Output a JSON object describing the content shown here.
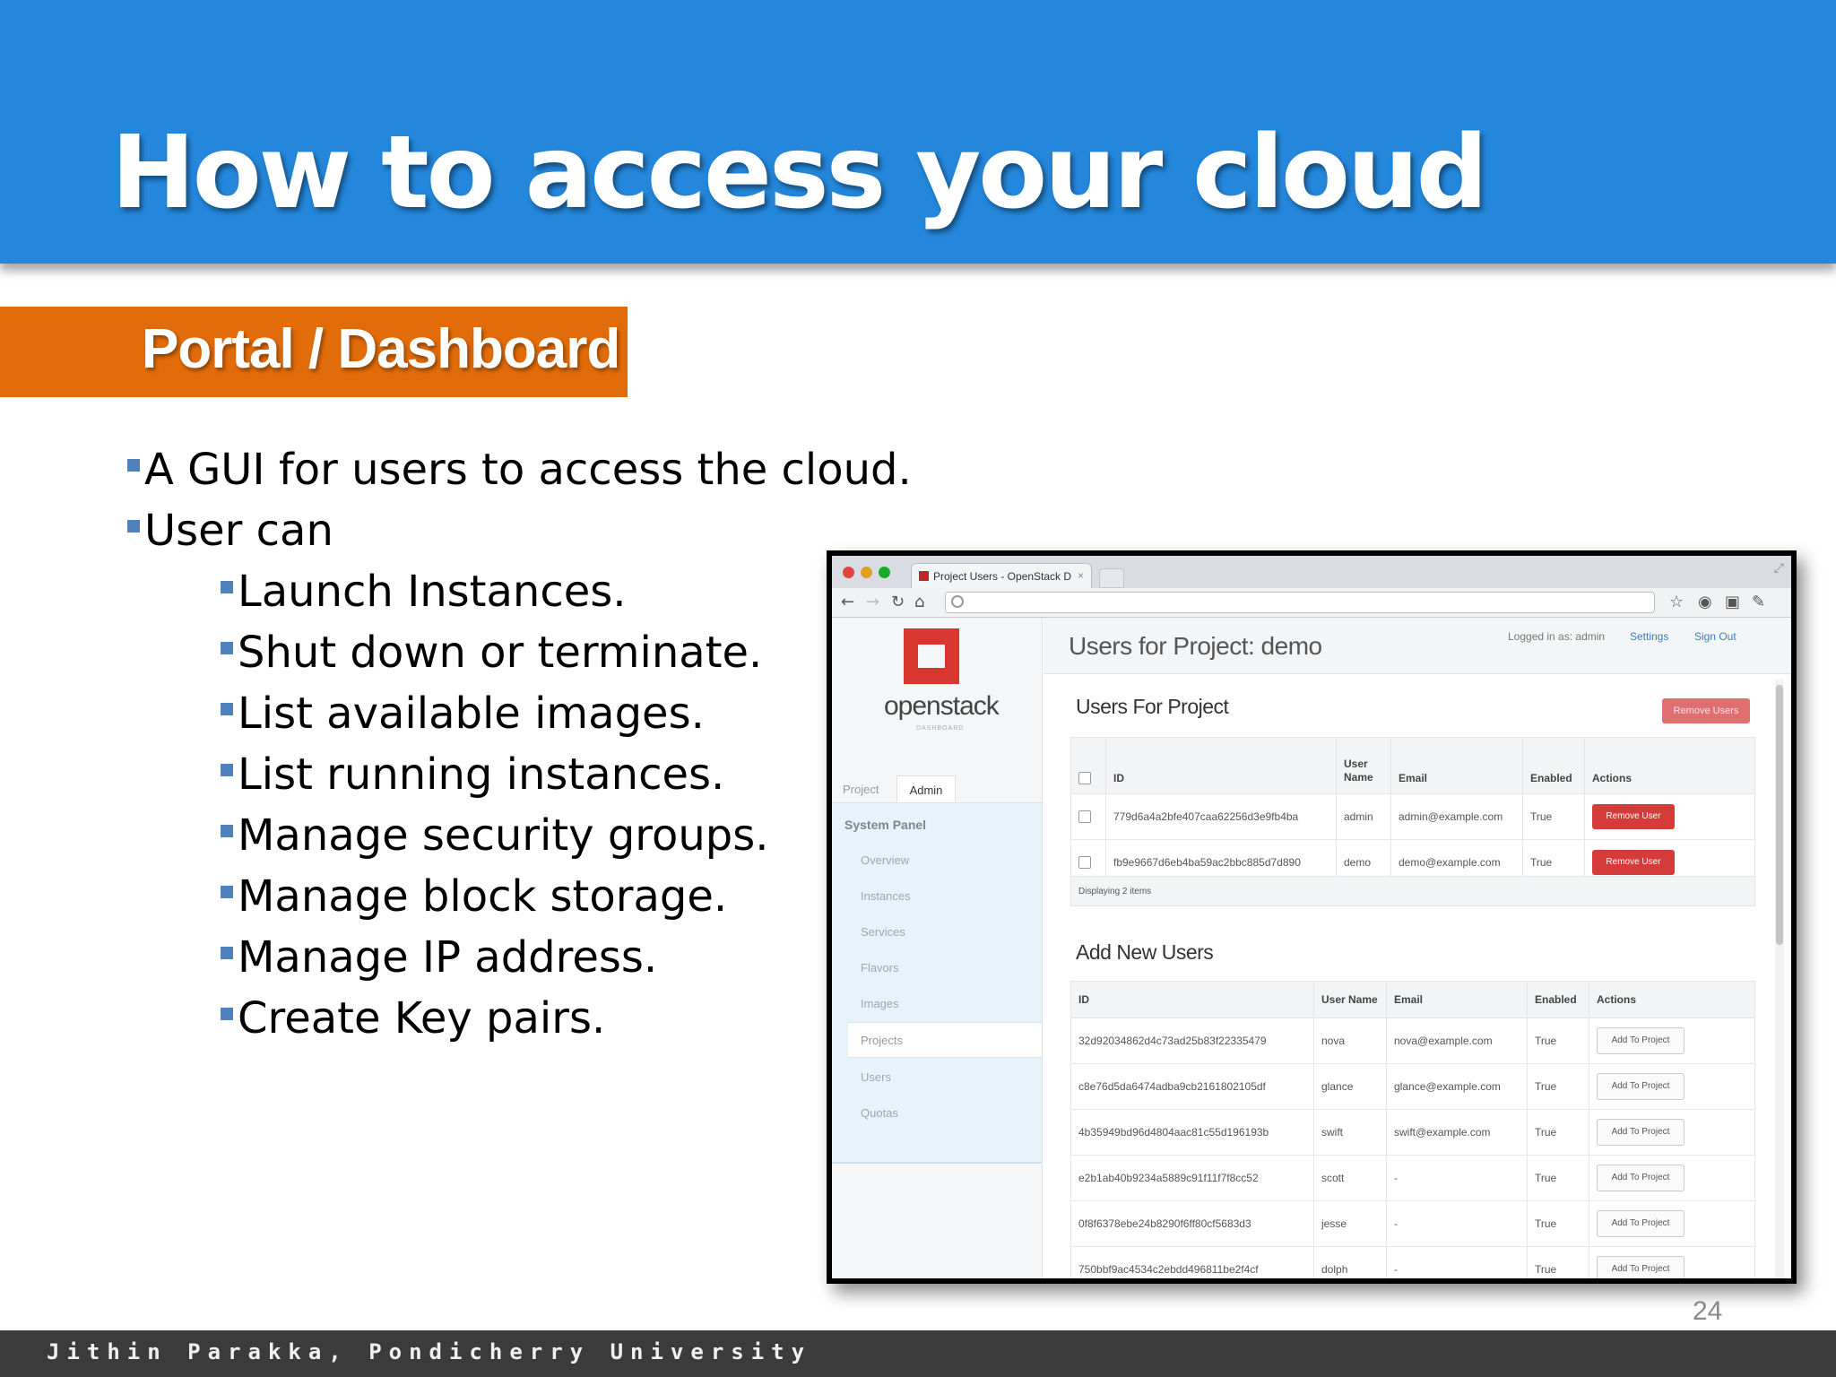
{
  "slide": {
    "title": "How to access your cloud",
    "section": "Portal / Dashboard",
    "bullets": [
      "A GUI for users to access the cloud.",
      "User can"
    ],
    "sub_bullets": [
      "Launch Instances.",
      "Shut down or terminate.",
      "List available images.",
      "List running instances.",
      "Manage security groups.",
      "Manage block storage.",
      "Manage IP address.",
      "Create Key pairs."
    ],
    "footer": "Jithin Parakka, Pondicherry University",
    "page_number": "24"
  },
  "colors": {
    "title_band": "#2487db",
    "section_band": "#e36c0a",
    "bullet": "#4f81bd",
    "footer": "#3b3b3b",
    "danger": "#d43b39",
    "link": "#3a7cc2"
  },
  "browser": {
    "tab_title": "Project Users - OpenStack D",
    "tab_close": "×",
    "icons": [
      "back-icon",
      "forward-icon",
      "reload-icon",
      "home-icon",
      "star-icon",
      "extension-icon",
      "wrench-icon"
    ]
  },
  "dashboard": {
    "logo": {
      "text": "openstack",
      "sub": "DASHBOARD"
    },
    "side_tabs": [
      "Project",
      "Admin"
    ],
    "system_panel": "System Panel",
    "nav_items": [
      "Overview",
      "Instances",
      "Services",
      "Flavors",
      "Images",
      "Projects",
      "Users",
      "Quotas"
    ],
    "active_nav": "Projects",
    "page_title": "Users for Project: demo",
    "logged_in": "Logged in as: admin",
    "settings": "Settings",
    "sign_out": "Sign Out",
    "users_section": "Users For Project",
    "remove_users": "Remove Users",
    "users_headers": [
      "ID",
      "User Name",
      "Email",
      "Enabled",
      "Actions"
    ],
    "users_header_name_lines": [
      "User",
      "Name"
    ],
    "users_rows": [
      {
        "id": "779d6a4a2bfe407caa62256d3e9fb4ba",
        "name": "admin",
        "email": "admin@example.com",
        "enabled": "True",
        "action": "Remove User"
      },
      {
        "id": "fb9e9667d6eb4ba59ac2bbc885d7d890",
        "name": "demo",
        "email": "demo@example.com",
        "enabled": "True",
        "action": "Remove User"
      }
    ],
    "displaying": "Displaying 2 items",
    "add_section": "Add New Users",
    "add_headers": [
      "ID",
      "User Name",
      "Email",
      "Enabled",
      "Actions"
    ],
    "add_rows": [
      {
        "id": "32d92034862d4c73ad25b83f22335479",
        "name": "nova",
        "email": "nova@example.com",
        "enabled": "True",
        "action": "Add To Project"
      },
      {
        "id": "c8e76d5da6474adba9cb2161802105df",
        "name": "glance",
        "email": "glance@example.com",
        "enabled": "True",
        "action": "Add To Project"
      },
      {
        "id": "4b35949bd96d4804aac81c55d196193b",
        "name": "swift",
        "email": "swift@example.com",
        "enabled": "True",
        "action": "Add To Project"
      },
      {
        "id": "e2b1ab40b9234a5889c91f11f7f8cc52",
        "name": "scott",
        "email": "-",
        "enabled": "True",
        "action": "Add To Project"
      },
      {
        "id": "0f8f6378ebe24b8290f6ff80cf5683d3",
        "name": "jesse",
        "email": "-",
        "enabled": "True",
        "action": "Add To Project"
      },
      {
        "id": "750bbf9ac4534c2ebdd496811be2f4cf",
        "name": "dolph",
        "email": "-",
        "enabled": "True",
        "action": "Add To Project"
      }
    ]
  }
}
